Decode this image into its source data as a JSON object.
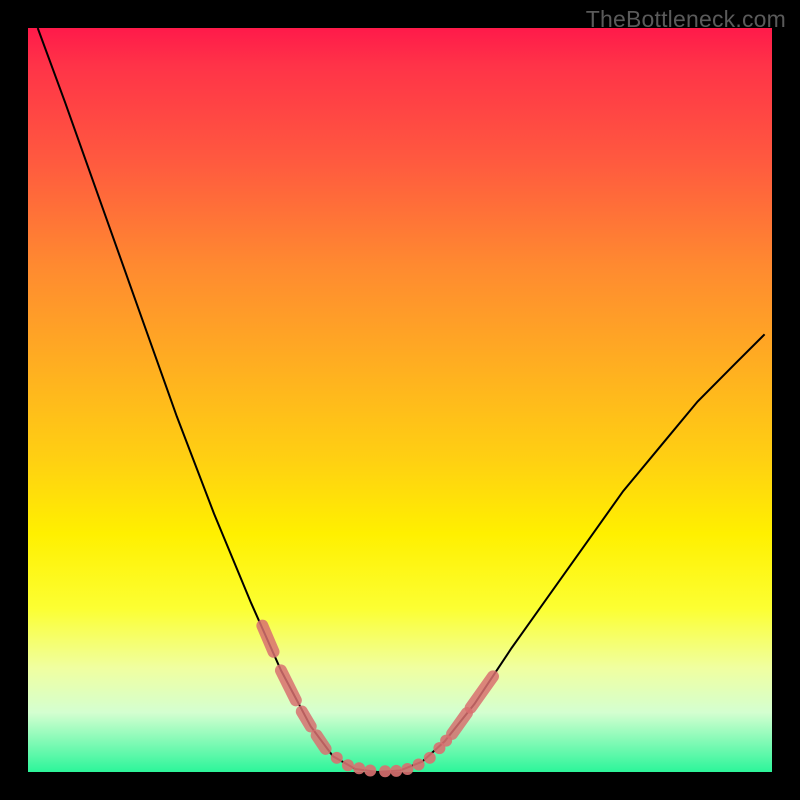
{
  "watermark": "TheBottleneck.com",
  "chart_data": {
    "type": "line",
    "title": "",
    "xlabel": "",
    "ylabel": "",
    "xlim": [
      0,
      100
    ],
    "ylim": [
      0,
      100
    ],
    "curve": [
      {
        "x": 1.3,
        "y": 100
      },
      {
        "x": 5,
        "y": 90
      },
      {
        "x": 10,
        "y": 76
      },
      {
        "x": 15,
        "y": 62
      },
      {
        "x": 20,
        "y": 48
      },
      {
        "x": 25,
        "y": 35
      },
      {
        "x": 30,
        "y": 23
      },
      {
        "x": 34,
        "y": 14
      },
      {
        "x": 38,
        "y": 6.5
      },
      {
        "x": 41,
        "y": 2.5
      },
      {
        "x": 44,
        "y": 0.8
      },
      {
        "x": 47,
        "y": 0.4
      },
      {
        "x": 50,
        "y": 0.6
      },
      {
        "x": 53,
        "y": 1.8
      },
      {
        "x": 56,
        "y": 4.5
      },
      {
        "x": 60,
        "y": 9.5
      },
      {
        "x": 65,
        "y": 17
      },
      {
        "x": 70,
        "y": 24
      },
      {
        "x": 75,
        "y": 31
      },
      {
        "x": 80,
        "y": 38
      },
      {
        "x": 85,
        "y": 44
      },
      {
        "x": 90,
        "y": 50
      },
      {
        "x": 95,
        "y": 55
      },
      {
        "x": 99,
        "y": 59
      }
    ],
    "marker_segments": [
      {
        "x1": 31.5,
        "y1": 20,
        "x2": 33,
        "y2": 16.5
      },
      {
        "x1": 34,
        "y1": 14,
        "x2": 36,
        "y2": 10
      },
      {
        "x1": 36.8,
        "y1": 8.5,
        "x2": 38,
        "y2": 6.5
      },
      {
        "x1": 38.8,
        "y1": 5.3,
        "x2": 40,
        "y2": 3.5
      },
      {
        "x1": 57,
        "y1": 5.5,
        "x2": 59,
        "y2": 8.3
      },
      {
        "x1": 59.5,
        "y1": 9,
        "x2": 62.5,
        "y2": 13.2
      }
    ],
    "marker_points": [
      {
        "x": 41.5,
        "y": 2.3
      },
      {
        "x": 43,
        "y": 1.3
      },
      {
        "x": 44.5,
        "y": 0.9
      },
      {
        "x": 46,
        "y": 0.6
      },
      {
        "x": 48,
        "y": 0.5
      },
      {
        "x": 49.5,
        "y": 0.55
      },
      {
        "x": 51,
        "y": 0.8
      },
      {
        "x": 52.5,
        "y": 1.4
      },
      {
        "x": 54,
        "y": 2.3
      },
      {
        "x": 55.3,
        "y": 3.6
      },
      {
        "x": 56.2,
        "y": 4.6
      }
    ],
    "gradient_stops": [
      {
        "pos": 0,
        "color": "#ff1a4a"
      },
      {
        "pos": 50,
        "color": "#ffd012"
      },
      {
        "pos": 100,
        "color": "#2cf59a"
      }
    ]
  }
}
